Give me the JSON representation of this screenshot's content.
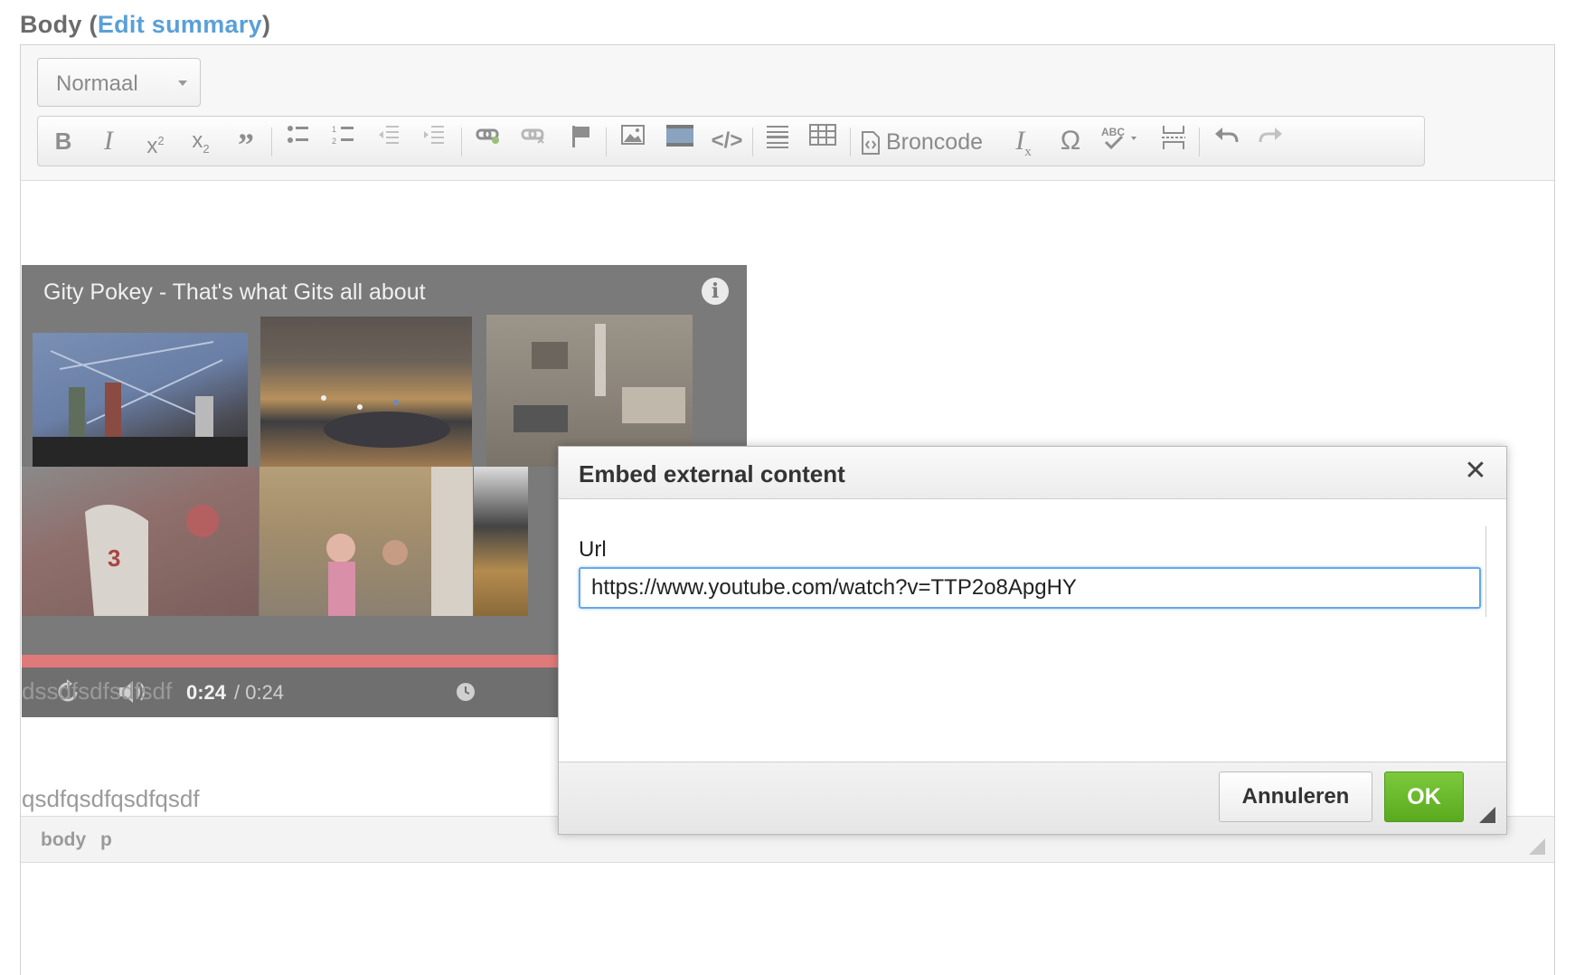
{
  "field": {
    "label": "Body",
    "open_paren": "(",
    "edit_summary": "Edit summary",
    "close_paren": ")"
  },
  "toolbar": {
    "format_value": "Normaal",
    "source_label": "Broncode",
    "buttons": [
      "bold-icon",
      "italic-icon",
      "superscript-icon",
      "subscript-icon",
      "blockquote-icon",
      "bulleted-list-icon",
      "numbered-list-icon",
      "outdent-icon",
      "indent-icon",
      "link-icon",
      "unlink-icon",
      "anchor-flag-icon",
      "image-icon",
      "media-icon",
      "code-icon",
      "horizontal-rule-icon",
      "table-icon",
      "source-icon",
      "remove-format-icon",
      "special-char-icon",
      "spellcheck-icon",
      "page-break-icon",
      "undo-icon",
      "redo-icon"
    ]
  },
  "video": {
    "title": "Gity Pokey - That's what Gits all about",
    "time_current": "0:24",
    "time_total": "/ 0:24"
  },
  "content": {
    "paragraph1": "dssdfsdfsdfsdf",
    "paragraph2": "qsdfqsdfqsdfqsdf"
  },
  "status_bar": {
    "crumbs": [
      "body",
      "p"
    ]
  },
  "dialog": {
    "title": "Embed external content",
    "url_label": "Url",
    "url_value": "https://www.youtube.com/watch?v=TTP2o8ApgHY",
    "cancel_label": "Annuleren",
    "ok_label": "OK"
  },
  "colors": {
    "link": "#5aa0d8",
    "ok_button": "#5aaa1f",
    "input_focus": "#64a8e8",
    "progress": "#e07a7a"
  }
}
